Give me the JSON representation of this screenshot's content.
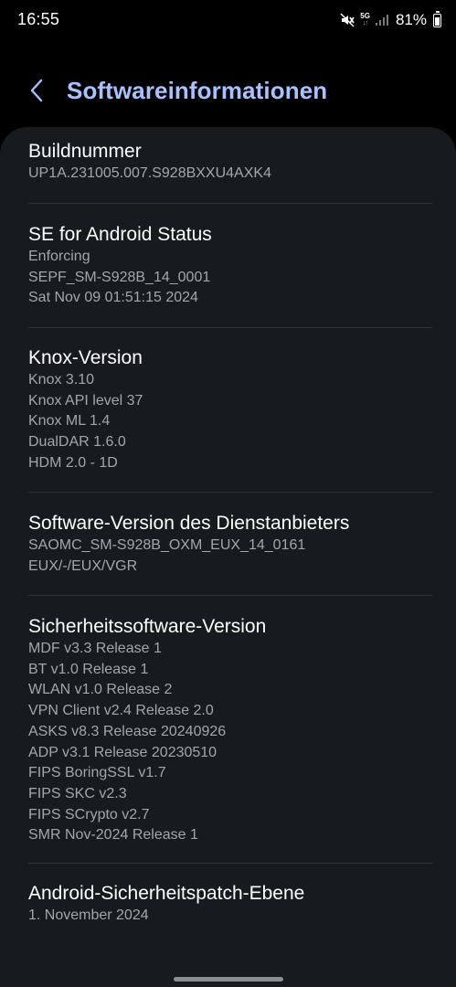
{
  "status_bar": {
    "time": "16:55",
    "network": "5G",
    "battery": "81%",
    "battery_level": 0.81
  },
  "header": {
    "back_icon": "chevron-left-icon",
    "title": "Softwareinformationen",
    "title_color": "#a9c1ff"
  },
  "sections": [
    {
      "title": "Buildnummer",
      "values": [
        "UP1A.231005.007.S928BXXU4AXK4"
      ]
    },
    {
      "title": "SE for Android Status",
      "values": [
        "Enforcing",
        "SEPF_SM-S928B_14_0001",
        "Sat Nov 09 01:51:15 2024"
      ]
    },
    {
      "title": "Knox-Version",
      "values": [
        "Knox 3.10",
        "Knox API level 37",
        "Knox ML 1.4",
        "DualDAR 1.6.0",
        "HDM 2.0 - 1D"
      ]
    },
    {
      "title": "Software-Version des Dienstanbieters",
      "values": [
        "SAOMC_SM-S928B_OXM_EUX_14_0161",
        "EUX/-/EUX/VGR"
      ]
    },
    {
      "title": "Sicherheitssoftware-Version",
      "values": [
        "MDF v3.3 Release 1",
        "BT v1.0 Release 1",
        "WLAN v1.0 Release 2",
        "VPN Client v2.4 Release 2.0",
        "ASKS v8.3  Release 20240926",
        "ADP v3.1 Release 20230510",
        "FIPS BoringSSL v1.7",
        "FIPS SKC v2.3",
        "FIPS SCrypto v2.7",
        "SMR Nov-2024 Release 1"
      ]
    },
    {
      "title": "Android-Sicherheitspatch-Ebene",
      "values": [
        "1. November 2024"
      ]
    }
  ]
}
